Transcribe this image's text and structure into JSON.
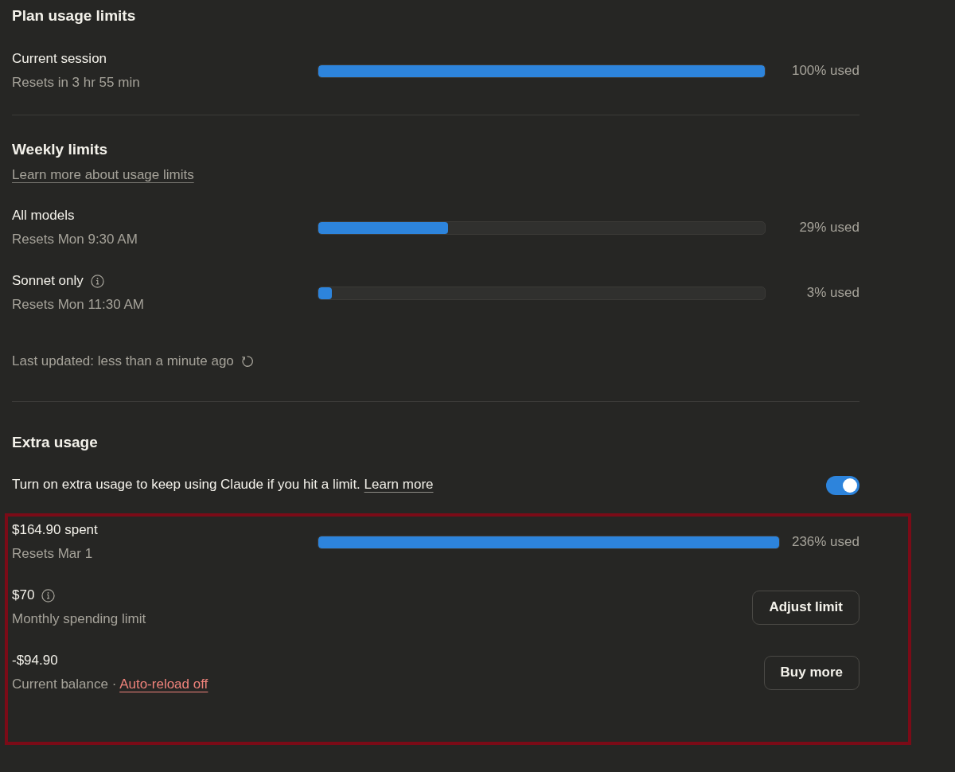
{
  "plan_usage": {
    "title": "Plan usage limits",
    "meters": [
      {
        "label": "Current session",
        "info": false,
        "sublabel": "Resets in 3 hr 55 min",
        "level": 1,
        "reading": "100% used"
      }
    ]
  },
  "weekly_limits": {
    "title": "Weekly limits",
    "link": "Learn more about usage limits",
    "meters": [
      {
        "label": "All models",
        "info": false,
        "sublabel": "Resets Mon 9:30 AM",
        "level": 0.29,
        "reading": "29% used"
      },
      {
        "label": "Sonnet only",
        "info": true,
        "sublabel": "Resets Mon 11:30 AM",
        "level": 0.03,
        "reading": "3% used"
      }
    ],
    "last_updated": "Last updated: less than a minute ago"
  },
  "extra_usage": {
    "title": "Extra usage",
    "description": "Turn on extra usage to keep using Claude if you hit a limit.",
    "link": "Learn more",
    "enabled": true,
    "highlighted": true,
    "rows": [
      {
        "kind": "meter",
        "label": "$164.90 spent",
        "info": false,
        "sublabel": "Resets Mar 1",
        "level": 1,
        "reading": "236% used"
      },
      {
        "kind": "amount",
        "label": "$70",
        "info": true,
        "sublabel": "Monthly spending limit",
        "button": "Adjust limit"
      },
      {
        "kind": "amount",
        "label": "-$94.90",
        "info": false,
        "sublabel": "Current balance ·",
        "link": "Auto-reload off",
        "button": "Buy more"
      }
    ]
  }
}
